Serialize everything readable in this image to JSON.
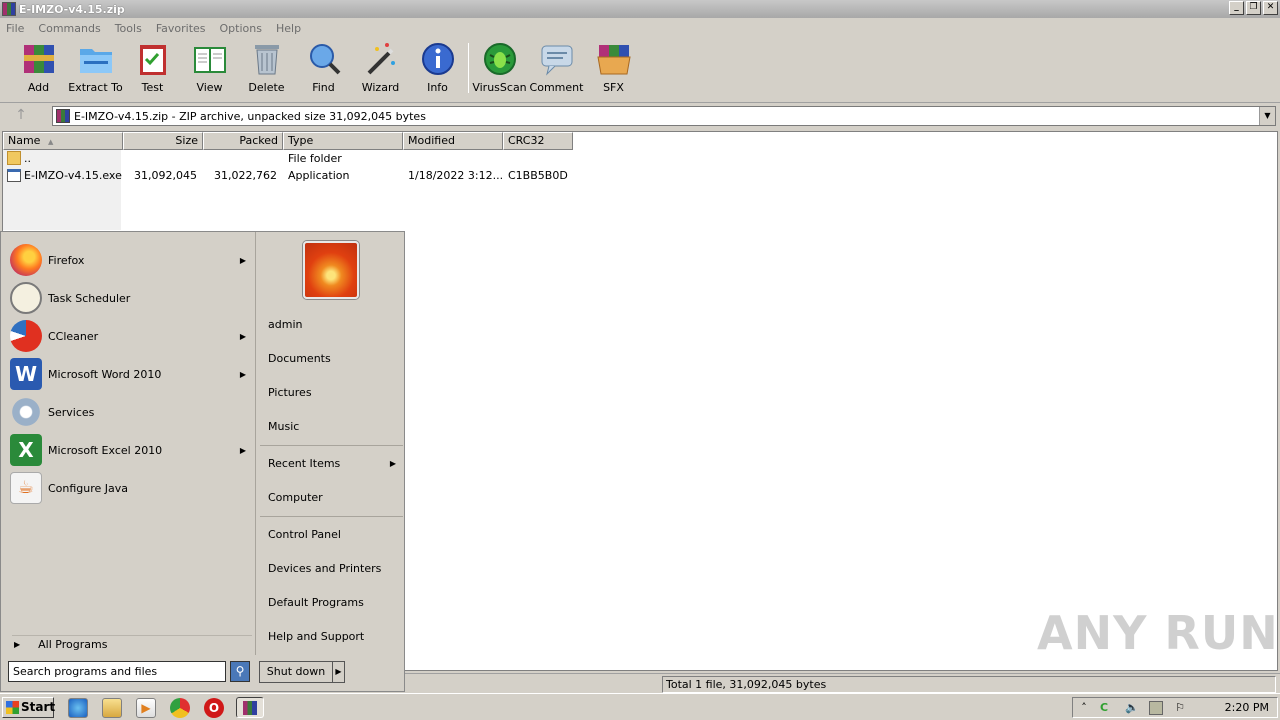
{
  "window": {
    "title": "E-IMZO-v4.15.zip",
    "btn_min": "_",
    "btn_restore": "❐",
    "btn_close": "✕"
  },
  "menu": [
    "File",
    "Commands",
    "Tools",
    "Favorites",
    "Options",
    "Help"
  ],
  "toolbar": {
    "add": "Add",
    "extract": "Extract To",
    "test": "Test",
    "view": "View",
    "delete": "Delete",
    "find": "Find",
    "wizard": "Wizard",
    "info": "Info",
    "virusscan": "VirusScan",
    "comment": "Comment",
    "sfx": "SFX"
  },
  "address": {
    "text": "E-IMZO-v4.15.zip - ZIP archive, unpacked size 31,092,045 bytes",
    "up": "↑",
    "dropdown": "▼"
  },
  "columns": {
    "name": "Name",
    "sort": "▲",
    "size": "Size",
    "packed": "Packed",
    "type": "Type",
    "modified": "Modified",
    "crc": "CRC32"
  },
  "files": [
    {
      "name": "..",
      "size": "",
      "packed": "",
      "type": "File folder",
      "modified": "",
      "crc": ""
    },
    {
      "name": "E-IMZO-v4.15.exe",
      "size": "31,092,045",
      "packed": "31,022,762",
      "type": "Application",
      "modified": "1/18/2022 3:12...",
      "crc": "C1BB5B0D"
    }
  ],
  "status": {
    "text": "Total 1 file, 31,092,045 bytes"
  },
  "watermark": "ANY RUN",
  "startmenu": {
    "programs": [
      "Firefox",
      "Task Scheduler",
      "CCleaner",
      "Microsoft Word 2010",
      "Services",
      "Microsoft Excel 2010",
      "Configure Java"
    ],
    "all_programs": "All Programs",
    "search_placeholder": "Search programs and files",
    "right": {
      "user": "admin",
      "documents": "Documents",
      "pictures": "Pictures",
      "music": "Music",
      "recent": "Recent Items",
      "computer": "Computer",
      "control_panel": "Control Panel",
      "devices": "Devices and Printers",
      "default_programs": "Default Programs",
      "help": "Help and Support"
    },
    "shutdown": "Shut down"
  },
  "taskbar": {
    "start": "Start",
    "clock": "2:20 PM"
  }
}
